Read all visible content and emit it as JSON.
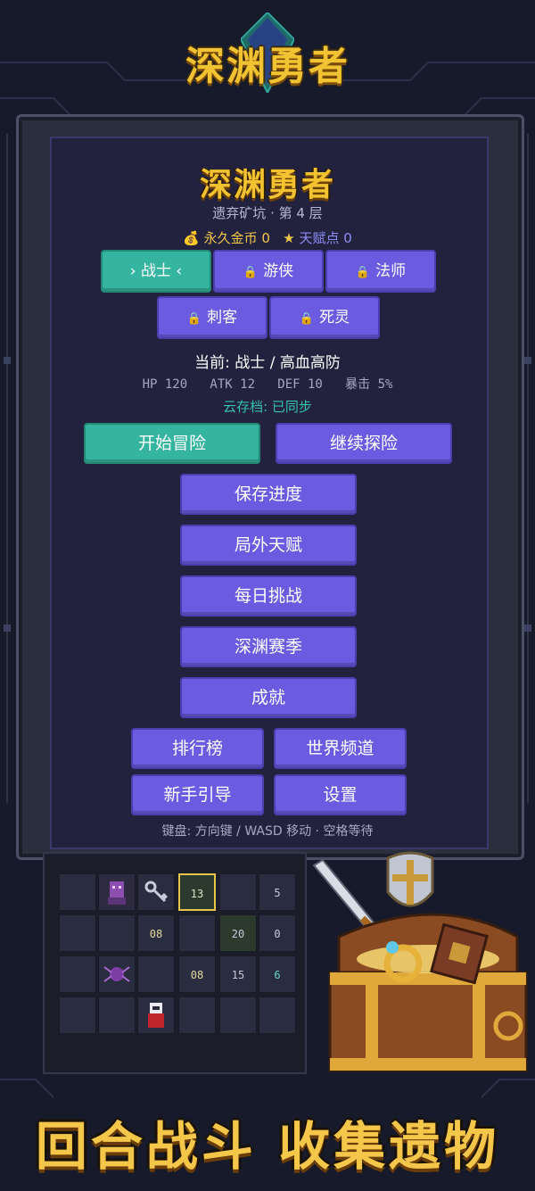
{
  "logo": "深渊勇者",
  "title": "深渊勇者",
  "subtitle": "遗弃矿坑 · 第 4 层",
  "currency": {
    "gold_icon": "money-bag-icon",
    "gold_label": "永久金币 0",
    "talent_icon": "star-icon",
    "talent_label": "天赋点 0"
  },
  "classes": [
    {
      "label": "› 战士 ‹",
      "locked": false,
      "selected": true
    },
    {
      "label": "游侠",
      "locked": true
    },
    {
      "label": "法师",
      "locked": true
    },
    {
      "label": "刺客",
      "locked": true
    },
    {
      "label": "死灵",
      "locked": true
    }
  ],
  "current": "当前: 战士 / 高血高防",
  "stats": "HP 120   ATK 12   DEF 10   暴击 5%",
  "cloud": "云存档: 已同步",
  "menu": {
    "start": "开始冒险",
    "continue": "继续探险",
    "save": "保存进度",
    "talents": "局外天赋",
    "daily": "每日挑战",
    "season": "深渊赛季",
    "achievements": "成就",
    "leaderboard": "排行榜",
    "world": "世界频道",
    "tutorial": "新手引导",
    "settings": "设置"
  },
  "controls_hint": "键盘: 方向键 / WASD 移动 · 空格等待",
  "board_numbers": {
    "a": "13",
    "b": "5",
    "c": "08",
    "d": "20",
    "e": "0",
    "f": "08",
    "g": "15",
    "h": "6"
  },
  "banner": "回合战斗  收集遗物",
  "colors": {
    "accent": "#6a5be0",
    "selected": "#35b5a0",
    "gold": "#f2c230"
  }
}
